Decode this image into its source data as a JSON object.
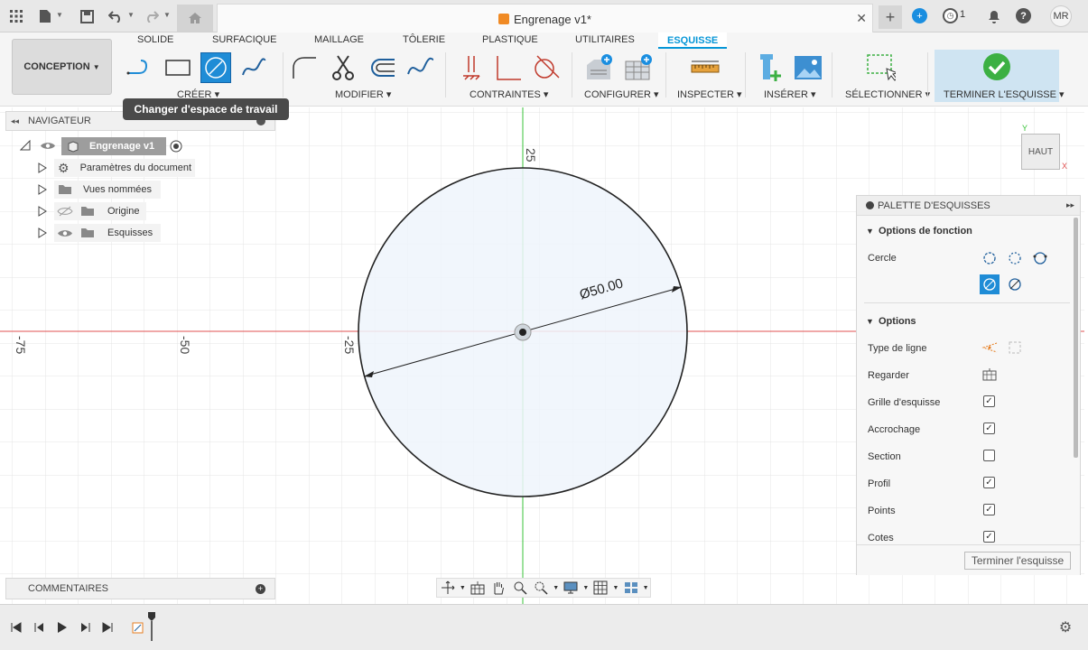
{
  "titlebar": {
    "doc_title": "Engrenage v1*",
    "avatar_initials": "MR",
    "job_count": "1"
  },
  "ribbon": {
    "workspace": "CONCEPTION",
    "tabs": [
      "SOLIDE",
      "SURFACIQUE",
      "MAILLAGE",
      "TÔLERIE",
      "PLASTIQUE",
      "UTILITAIRES",
      "ESQUISSE"
    ],
    "active_tab": "ESQUISSE",
    "groups": {
      "create": "CRÉER",
      "modify": "MODIFIER",
      "constraints": "CONTRAINTES",
      "configure": "CONFIGURER",
      "inspect": "INSPECTER",
      "insert": "INSÉRER",
      "select": "SÉLECTIONNER",
      "finish": "TERMINER L'ESQUISSE"
    }
  },
  "tooltip": "Changer d'espace de travail",
  "navigator": {
    "title": "NAVIGATEUR",
    "root": "Engrenage v1",
    "items": [
      "Paramètres du document",
      "Vues nommées",
      "Origine",
      "Esquisses"
    ]
  },
  "canvas": {
    "axis_labels": {
      "x_m75": "-75",
      "x_m50": "-50",
      "x_m25": "-25",
      "y_25": "25"
    },
    "dimension": "Ø50.00",
    "view_label": "HAUT",
    "view_axis_y": "Y",
    "view_axis_x": "X"
  },
  "palette": {
    "title": "PALETTE D'ESQUISSES",
    "feature_options": "Options de fonction",
    "circle_label": "Cercle",
    "options_title": "Options",
    "rows": [
      {
        "label": "Type de ligne"
      },
      {
        "label": "Regarder"
      },
      {
        "label": "Grille d'esquisse",
        "checked": true
      },
      {
        "label": "Accrochage",
        "checked": true
      },
      {
        "label": "Section",
        "checked": false
      },
      {
        "label": "Profil",
        "checked": true
      },
      {
        "label": "Points",
        "checked": true
      },
      {
        "label": "Cotes",
        "checked": true
      }
    ],
    "finish_button": "Terminer l'esquisse"
  },
  "comments": {
    "title": "COMMENTAIRES"
  },
  "colors": {
    "accent": "#0696d7",
    "selected_tool": "#1f8cd6",
    "finish_green": "#3cb043",
    "x_axis": "#e05050",
    "y_axis": "#39c339",
    "profile_fill": "#eef5fb"
  }
}
